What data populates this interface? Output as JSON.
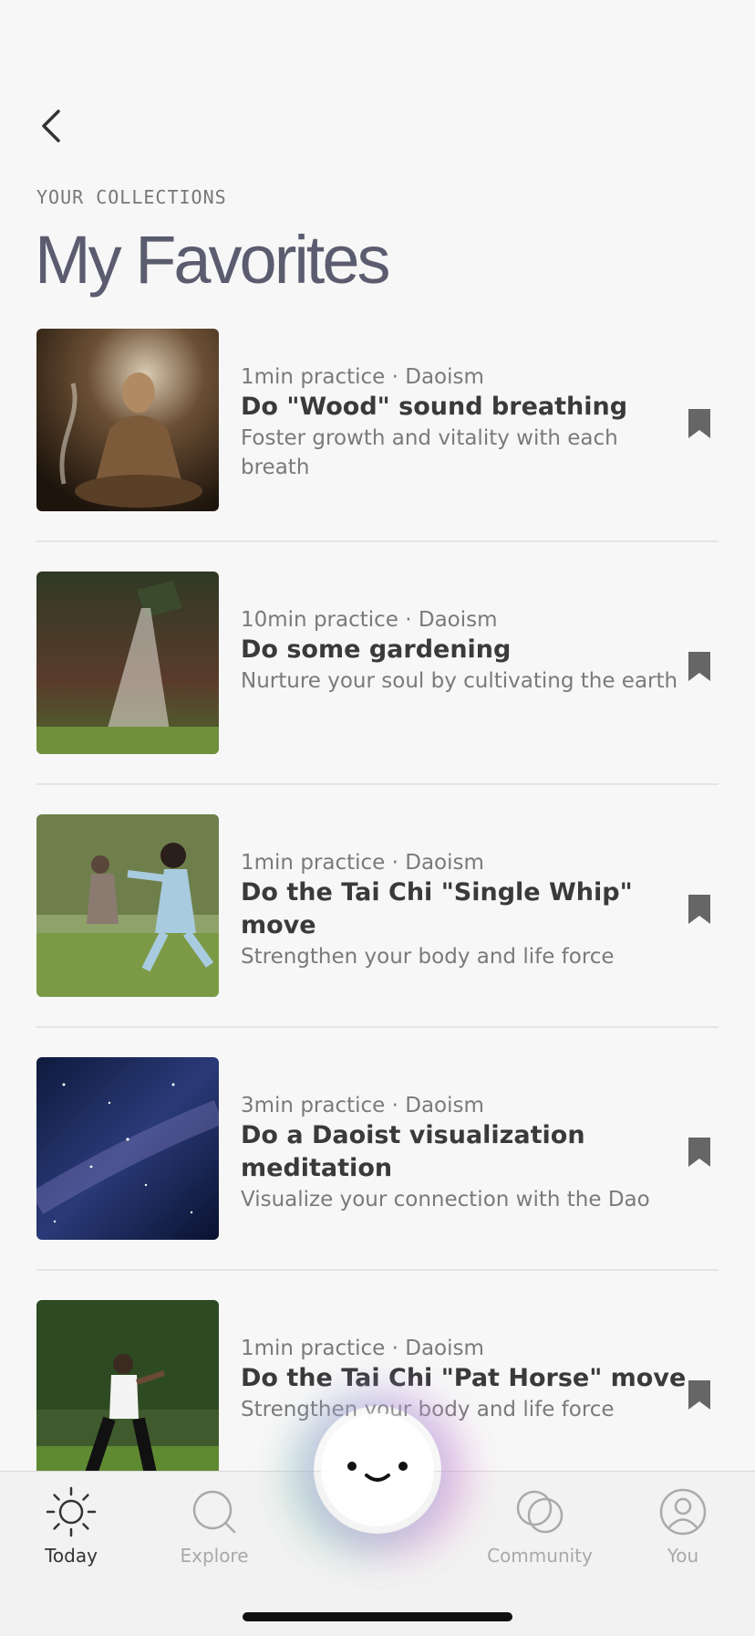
{
  "header": {
    "overline": "YOUR COLLECTIONS",
    "title": "My Favorites"
  },
  "favorites": [
    {
      "meta": "1min practice · Daoism",
      "title": "Do \"Wood\" sound breathing",
      "description": "Foster growth and vitality with each breath",
      "image": "woman-meditating-incense"
    },
    {
      "meta": "10min practice · Daoism",
      "title": "Do some gardening",
      "description": "Nurture your soul by cultivating the earth",
      "image": "watering-can-plants"
    },
    {
      "meta": "1min practice · Daoism",
      "title": "Do the Tai Chi \"Single Whip\" move",
      "description": "Strengthen your body and life force",
      "image": "tai-chi-group-park"
    },
    {
      "meta": "3min practice · Daoism",
      "title": "Do a Daoist visualization meditation",
      "description": "Visualize your connection with the Dao",
      "image": "milky-way-night-sky"
    },
    {
      "meta": "1min practice · Daoism",
      "title": "Do the Tai Chi \"Pat Horse\" move",
      "description": "Strengthen your body and life force",
      "image": "tai-chi-man-park"
    }
  ],
  "tabbar": {
    "tabs": [
      {
        "label": "Today",
        "icon": "sun-icon",
        "active": true
      },
      {
        "label": "Explore",
        "icon": "search-icon",
        "active": false
      },
      {
        "label": "Community",
        "icon": "overlapping-circles-icon",
        "active": false
      },
      {
        "label": "You",
        "icon": "person-icon",
        "active": false
      }
    ]
  },
  "colors": {
    "title": "#5c5c70",
    "bookmark": "#666666",
    "active_tab": "#333333",
    "inactive_tab": "#a9a9a9"
  }
}
